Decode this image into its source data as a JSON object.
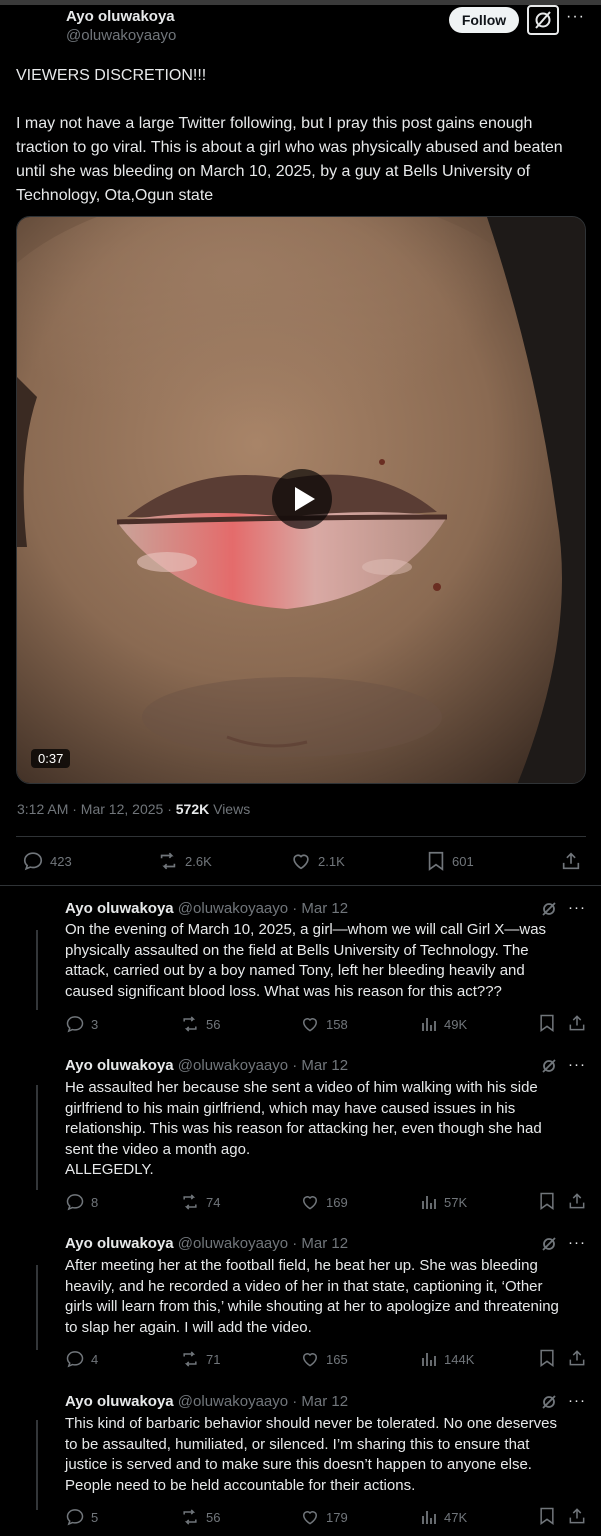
{
  "post": {
    "author_name": "Ayo oluwakoya",
    "author_handle": "@oluwakoyaayo",
    "follow_label": "Follow",
    "more_label": "···",
    "text_line1": "VIEWERS DISCRETION!!!",
    "text_body": "I may not have a large Twitter following, but I pray this post gains enough traction to go viral. This is about a girl who was physically abused and beaten until she was bleeding on March 10, 2025, by a guy at Bells University of Technology, Ota,Ogun state",
    "video_duration": "0:37",
    "timestamp": "3:12 AM · Mar 12, 2025 · ",
    "views_count": "572K",
    "views_label": " Views",
    "replies": "423",
    "reposts": "2.6K",
    "likes": "2.1K",
    "bookmarks": "601"
  },
  "thread": [
    {
      "name": "Ayo oluwakoya",
      "handle_date": " @oluwakoyaayo · Mar 12",
      "text": "On the evening of March 10, 2025, a girl—whom we will call Girl X—was physically assaulted on the field at Bells University of Technology. The attack, carried out by a boy named Tony, left her bleeding heavily and caused significant blood loss. What was his reason for this act???",
      "replies": "3",
      "reposts": "56",
      "likes": "158",
      "views": "49K"
    },
    {
      "name": "Ayo oluwakoya",
      "handle_date": " @oluwakoyaayo · Mar 12",
      "text": "He assaulted her because she sent a video of him walking with his side girlfriend to his main girlfriend, which may have caused issues in his relationship. This was his reason for attacking her, even though she had sent the video a month ago.\nALLEGEDLY.",
      "replies": "8",
      "reposts": "74",
      "likes": "169",
      "views": "57K"
    },
    {
      "name": "Ayo oluwakoya",
      "handle_date": " @oluwakoyaayo · Mar 12",
      "text": "After meeting her at the football field, he beat her up. She was bleeding heavily, and he recorded a video of her in that state, captioning it, ‘Other girls will learn from this,’ while shouting at her to apologize and threatening to slap her again. I will add the video.",
      "replies": "4",
      "reposts": "71",
      "likes": "165",
      "views": "144K"
    },
    {
      "name": "Ayo oluwakoya",
      "handle_date": " @oluwakoyaayo · Mar 12",
      "text": "This kind of barbaric behavior should never be tolerated. No one deserves to be assaulted, humiliated, or silenced. I’m sharing this to ensure that justice is served and to make sure this doesn’t happen to anyone else. People need to be held accountable for their actions.",
      "replies": "5",
      "reposts": "56",
      "likes": "179",
      "views": "47K"
    }
  ],
  "icons": {
    "reply": "reply-icon",
    "repost": "repost-icon",
    "like": "like-icon",
    "bookmark": "bookmark-icon",
    "share": "share-icon",
    "views": "views-icon",
    "grok": "grok-icon",
    "play": "play-icon"
  },
  "colors": {
    "background": "#000000",
    "text": "#e7e9ea",
    "muted": "#71767b",
    "border": "#2f3336"
  }
}
